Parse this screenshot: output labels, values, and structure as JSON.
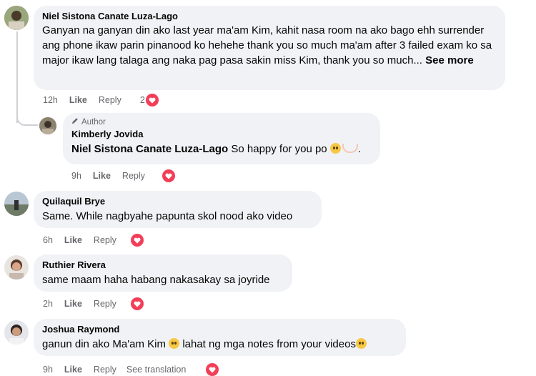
{
  "comments": [
    {
      "author": "Niel Sistona Canate Luza-Lago",
      "text": "Ganyan na ganyan din ako last year ma'am Kim, kahit nasa room na ako bago ehh surrender ang phone ikaw parin pinanood ko hehehe thank you so much ma'am after 3 failed exam ko sa major ikaw lang talaga ang naka pag pasa sakin miss Kim, thank you so much...",
      "see_more": "See more",
      "time": "12h",
      "like": "Like",
      "reply": "Reply",
      "reaction_count": "2"
    },
    {
      "badge": "Author",
      "author": "Kimberly Jovida",
      "mention": "Niel Sistona Canate Luza-Lago",
      "text": "So happy for you po",
      "text_end": ".",
      "time": "9h",
      "like": "Like",
      "reply": "Reply"
    },
    {
      "author": "Quilaquil Brye",
      "text": "Same. While nagbyahe papunta skol nood ako video",
      "time": "6h",
      "like": "Like",
      "reply": "Reply"
    },
    {
      "author": "Ruthier Rivera",
      "text": "same maam haha habang nakasakay sa joyride",
      "time": "2h",
      "like": "Like",
      "reply": "Reply"
    },
    {
      "author": "Joshua Raymond",
      "text_a": "ganun din ako Ma'am Kim",
      "text_b": "lahat ng mga notes from your videos",
      "time": "9h",
      "like": "Like",
      "reply": "Reply",
      "translate": "See translation"
    }
  ],
  "colors": {
    "bubble": "#f0f2f5",
    "meta_text": "#65676b",
    "heart": "#f33e58",
    "thread_line": "#ced0d4"
  },
  "icons": {
    "reaction": "heart-icon",
    "author_badge": "pen-icon",
    "emoji": "pleading-face-icon"
  }
}
